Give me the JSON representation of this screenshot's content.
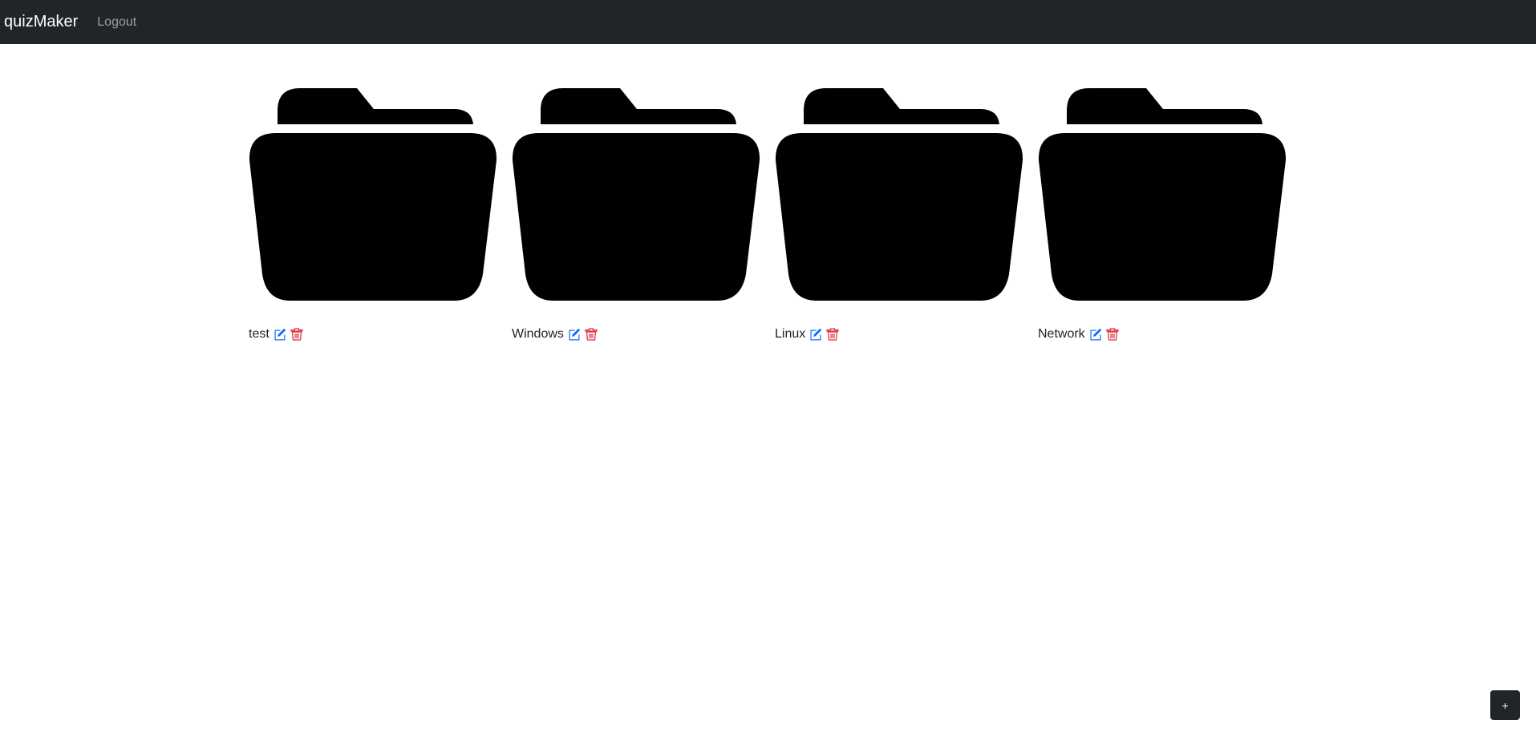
{
  "navbar": {
    "brand": "quizMaker",
    "logout": "Logout"
  },
  "folders": [
    {
      "name": "test",
      "icon": "folder-icon",
      "edit_icon": "edit-icon",
      "delete_icon": "trash-icon"
    },
    {
      "name": "Windows",
      "icon": "folder-icon",
      "edit_icon": "edit-icon",
      "delete_icon": "trash-icon"
    },
    {
      "name": "Linux",
      "icon": "folder-icon",
      "edit_icon": "edit-icon",
      "delete_icon": "trash-icon"
    },
    {
      "name": "Network",
      "icon": "folder-icon",
      "edit_icon": "edit-icon",
      "delete_icon": "trash-icon"
    }
  ],
  "add_button": {
    "label": "+"
  },
  "colors": {
    "navbar_bg": "#212529",
    "edit_icon": "#0d6efd",
    "delete_icon": "#dc3545",
    "folder": "#000000"
  }
}
